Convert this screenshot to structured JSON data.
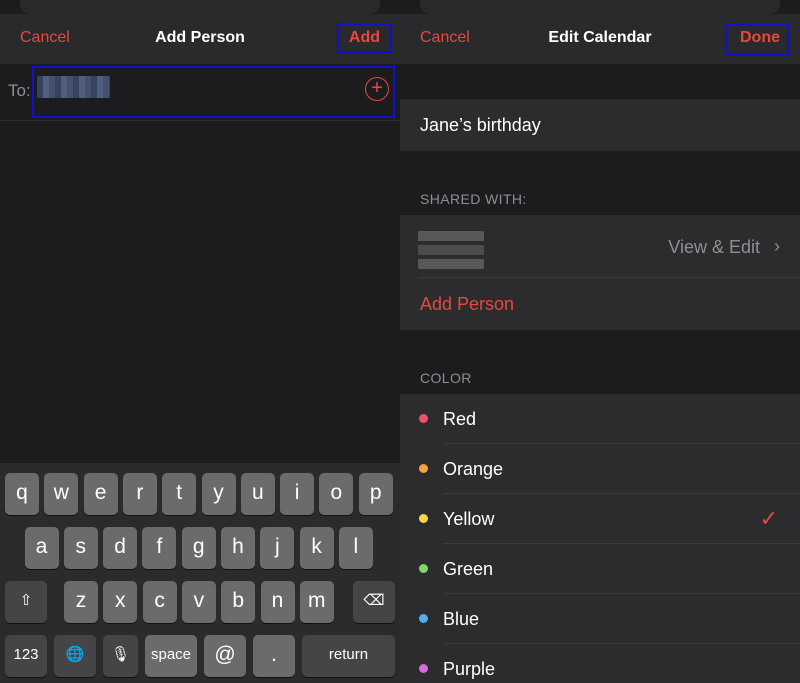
{
  "left": {
    "nav": {
      "cancel": "Cancel",
      "title": "Add Person",
      "add": "Add"
    },
    "to_label": "To:",
    "add_icon": "plus-circle-icon",
    "keyboard": {
      "row1": [
        "q",
        "w",
        "e",
        "r",
        "t",
        "y",
        "u",
        "i",
        "o",
        "p"
      ],
      "row2": [
        "a",
        "s",
        "d",
        "f",
        "g",
        "h",
        "j",
        "k",
        "l"
      ],
      "row3": [
        "z",
        "x",
        "c",
        "v",
        "b",
        "n",
        "m"
      ],
      "shift_icon": "shift-icon",
      "delete_icon": "backspace-icon",
      "globe_icon": "globe-icon",
      "mic_icon": "microphone-icon",
      "k123": "123",
      "space": "space",
      "at": "@",
      "dot": ".",
      "return": "return"
    }
  },
  "right": {
    "nav": {
      "cancel": "Cancel",
      "title": "Edit Calendar",
      "done": "Done"
    },
    "calendar_name": "Jane’s birthday",
    "shared_header": "SHARED WITH:",
    "permission": "View & Edit",
    "add_person": "Add Person",
    "color_header": "COLOR",
    "colors": [
      {
        "label": "Red",
        "color": "#f0506e"
      },
      {
        "label": "Orange",
        "color": "#f5a03a"
      },
      {
        "label": "Yellow",
        "color": "#f7d64a",
        "selected": true
      },
      {
        "label": "Green",
        "color": "#7bd86a"
      },
      {
        "label": "Blue",
        "color": "#4fb0f0"
      },
      {
        "label": "Purple",
        "color": "#d86ae0"
      }
    ]
  },
  "accent": "#e8473d"
}
